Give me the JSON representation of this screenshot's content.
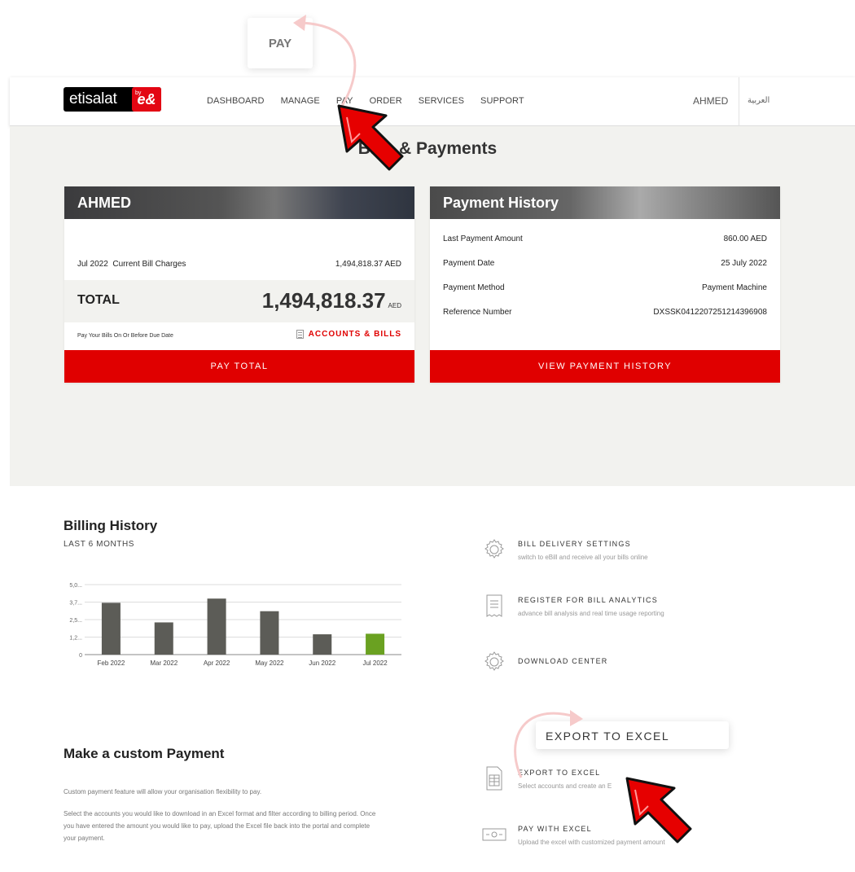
{
  "callouts": {
    "pay": "PAY",
    "export": "EXPORT TO EXCEL"
  },
  "header": {
    "logo_text": "etisalat",
    "logo_by": "by",
    "logo_mark": "e&",
    "nav": [
      "DASHBOARD",
      "MANAGE",
      "PAY",
      "ORDER",
      "SERVICES",
      "SUPPORT"
    ],
    "user": "AHMED",
    "language": "العربية"
  },
  "page_title": "Bills & Payments",
  "bill_card": {
    "name": "AHMED",
    "period": "Jul 2022",
    "charges_label": "Current Bill Charges",
    "charges_value": "1,494,818.37 AED",
    "total_label": "TOTAL",
    "total_value": "1,494,818.37",
    "currency": "AED",
    "due_note": "Pay Your Bills On Or Before Due Date",
    "accounts_link": "ACCOUNTS & BILLS",
    "button": "PAY TOTAL"
  },
  "payment_card": {
    "title": "Payment History",
    "rows": [
      {
        "label": "Last Payment Amount",
        "value": "860.00 AED"
      },
      {
        "label": "Payment Date",
        "value": "25 July 2022"
      },
      {
        "label": "Payment Method",
        "value": "Payment Machine"
      },
      {
        "label": "Reference Number",
        "value": "DXSSK0412207251214396908"
      }
    ],
    "button": "VIEW PAYMENT HISTORY"
  },
  "billing": {
    "title": "Billing History",
    "subtitle": "LAST 6 MONTHS"
  },
  "chart_data": {
    "type": "bar",
    "categories": [
      "Feb 2022",
      "Mar 2022",
      "Apr 2022",
      "May 2022",
      "Jun 2022",
      "Jul 2022"
    ],
    "values": [
      3.7,
      2.3,
      4.0,
      3.1,
      1.45,
      1.49
    ],
    "yticks": [
      "0",
      "1,2...",
      "2,5...",
      "3,7...",
      "5,0..."
    ],
    "ylim": [
      0,
      5.0
    ],
    "bar_color": "#5c5c57",
    "highlight_color": "#6aa121",
    "highlight_index": 5
  },
  "custom_payment": {
    "title": "Make a custom Payment",
    "p1": "Custom payment feature will allow your organisation flexibility to pay.",
    "p2": "Select the accounts you would like to download in an Excel format and filter according to billing period. Once you have entered the amount you would like to pay, upload the Excel file back into the portal and complete your payment."
  },
  "options": [
    {
      "icon": "gear-icon",
      "title": "BILL DELIVERY SETTINGS",
      "desc": "switch to eBill and receive all your bills online"
    },
    {
      "icon": "receipt-icon",
      "title": "REGISTER FOR BILL ANALYTICS",
      "desc": "advance bill analysis and real time usage reporting"
    },
    {
      "icon": "gear-icon",
      "title": "DOWNLOAD CENTER",
      "desc": ""
    },
    {
      "icon": "spreadsheet-icon",
      "title": "EXPORT TO EXCEL",
      "desc": "Select accounts and create an E"
    },
    {
      "icon": "cash-icon",
      "title": "PAY WITH EXCEL",
      "desc": "Upload the excel with customized payment amount"
    }
  ],
  "colors": {
    "accent": "#e00000",
    "panel": "#f2f2ef",
    "pointer": "#e00000"
  }
}
